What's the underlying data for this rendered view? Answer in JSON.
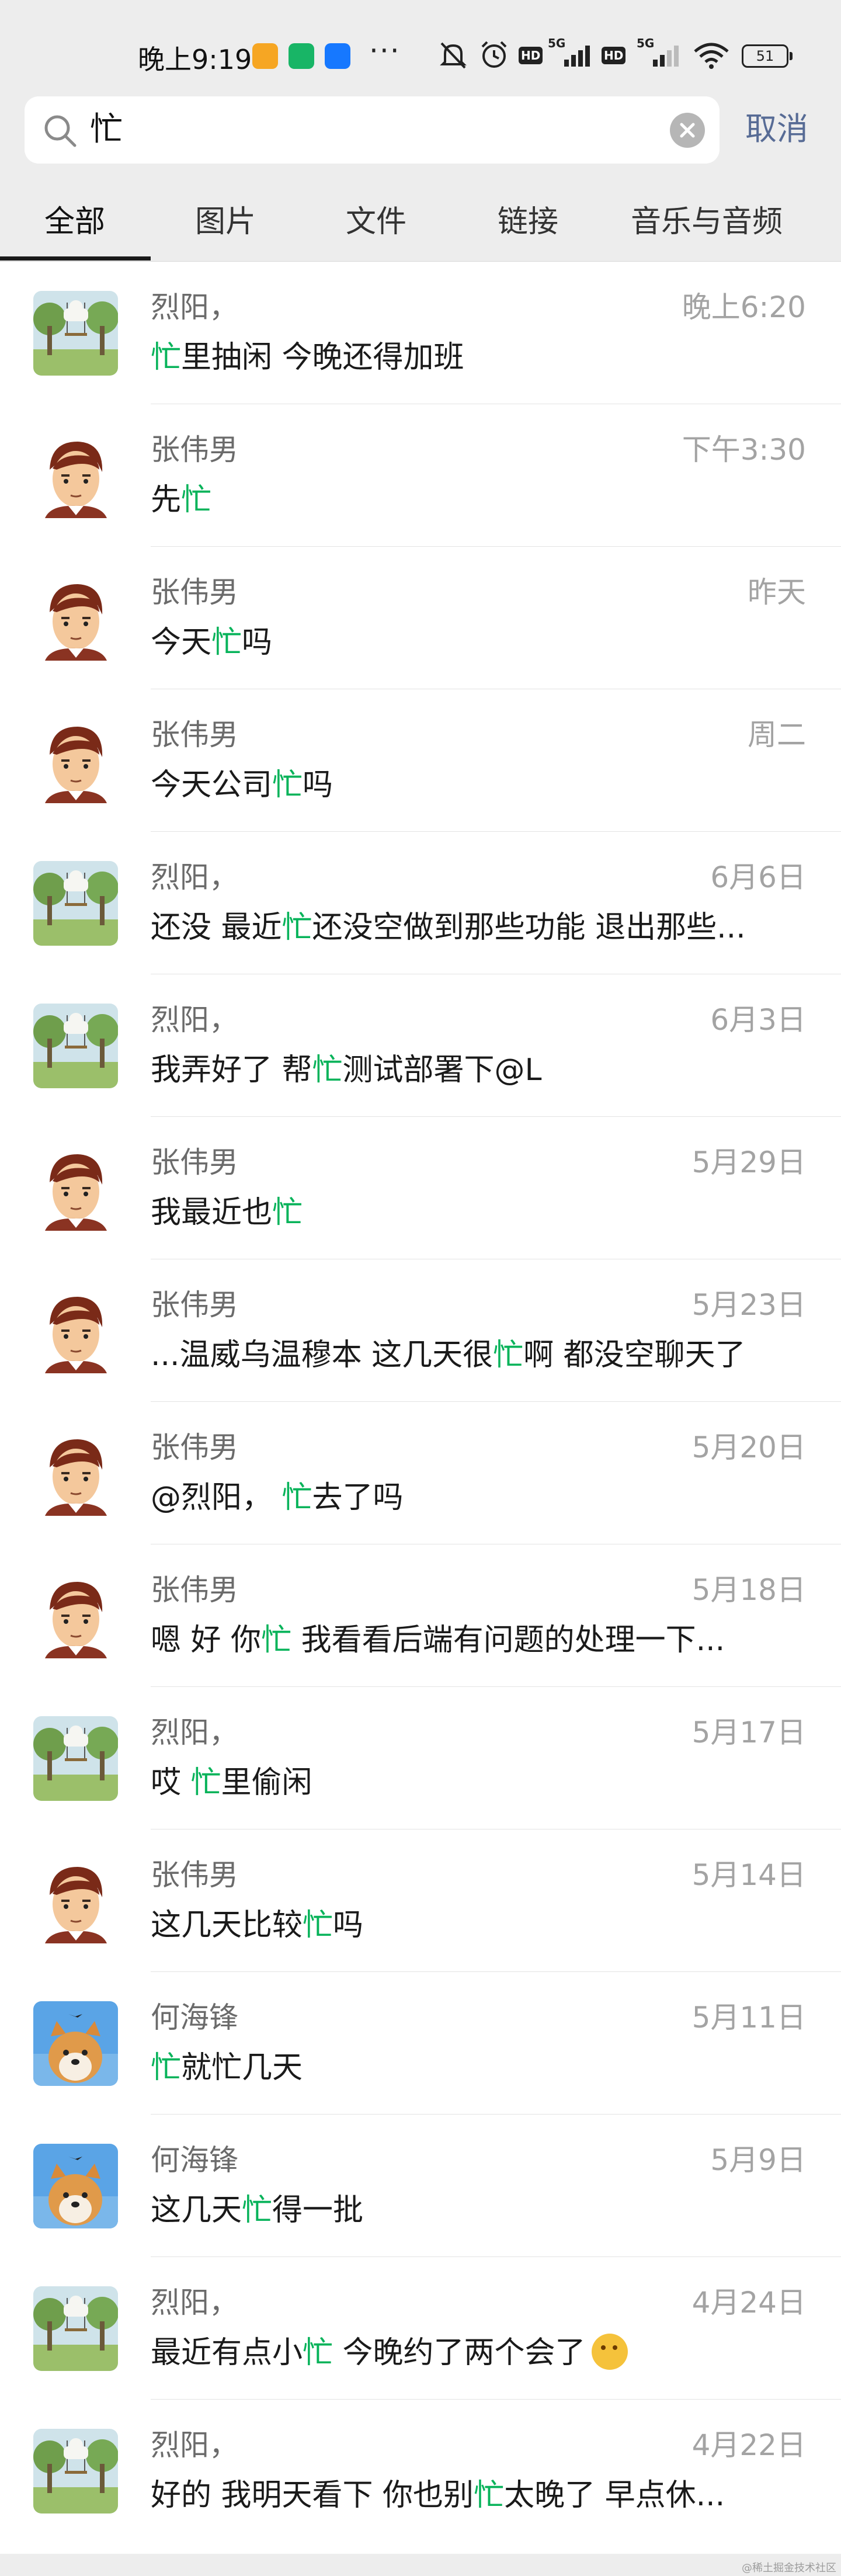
{
  "status_bar": {
    "time": "晚上9:19",
    "network_a": "5G",
    "network_b": "5G",
    "hd_a": "HD",
    "hd_b": "HD",
    "battery": "51",
    "more": "···"
  },
  "search": {
    "query": "忙",
    "cancel_label": "取消"
  },
  "tabs": [
    {
      "label": "全部",
      "active": true
    },
    {
      "label": "图片",
      "active": false
    },
    {
      "label": "文件",
      "active": false
    },
    {
      "label": "链接",
      "active": false
    },
    {
      "label": "音乐与音频",
      "active": false
    }
  ],
  "results": [
    {
      "name": "烈阳，",
      "date": "晚上6:20",
      "avatar": "park-swing-avatar",
      "before": "",
      "hl": "忙",
      "after": "里抽闲 今晚还得加班"
    },
    {
      "name": "张伟男",
      "date": "下午3:30",
      "avatar": "cartoon-man-avatar",
      "before": "先",
      "hl": "忙",
      "after": ""
    },
    {
      "name": "张伟男",
      "date": "昨天",
      "avatar": "cartoon-man-avatar",
      "before": "今天",
      "hl": "忙",
      "after": "吗"
    },
    {
      "name": "张伟男",
      "date": "周二",
      "avatar": "cartoon-man-avatar",
      "before": "今天公司",
      "hl": "忙",
      "after": "吗"
    },
    {
      "name": "烈阳，",
      "date": "6月6日",
      "avatar": "park-swing-avatar",
      "before": "还没 最近",
      "hl": "忙",
      "after": "还没空做到那些功能 退出那些..."
    },
    {
      "name": "烈阳，",
      "date": "6月3日",
      "avatar": "park-swing-avatar",
      "before": "我弄好了 帮",
      "hl": "忙",
      "after": "测试部署下@L"
    },
    {
      "name": "张伟男",
      "date": "5月29日",
      "avatar": "cartoon-man-avatar",
      "before": "我最近也",
      "hl": "忙",
      "after": ""
    },
    {
      "name": "张伟男",
      "date": "5月23日",
      "avatar": "cartoon-man-avatar",
      "before": "...温威乌温穆本 这几天很",
      "hl": "忙",
      "after": "啊 都没空聊天了"
    },
    {
      "name": "张伟男",
      "date": "5月20日",
      "avatar": "cartoon-man-avatar",
      "before": "@烈阳， ",
      "hl": "忙",
      "after": "去了吗"
    },
    {
      "name": "张伟男",
      "date": "5月18日",
      "avatar": "cartoon-man-avatar",
      "before": "嗯 好 你",
      "hl": "忙",
      "after": " 我看看后端有问题的处理一下..."
    },
    {
      "name": "烈阳，",
      "date": "5月17日",
      "avatar": "park-swing-avatar",
      "before": "哎 ",
      "hl": "忙",
      "after": "里偷闲"
    },
    {
      "name": "张伟男",
      "date": "5月14日",
      "avatar": "cartoon-man-avatar",
      "before": "这几天比较",
      "hl": "忙",
      "after": "吗"
    },
    {
      "name": "何海锋",
      "date": "5月11日",
      "avatar": "shiba-dog-avatar",
      "before": "",
      "hl": "忙",
      "after": "就忙几天"
    },
    {
      "name": "何海锋",
      "date": "5月9日",
      "avatar": "shiba-dog-avatar",
      "before": "这几天",
      "hl": "忙",
      "after": "得一批"
    },
    {
      "name": "烈阳，",
      "date": "4月24日",
      "avatar": "park-swing-avatar",
      "before": "最近有点小",
      "hl": "忙",
      "after": " 今晚约了两个会了",
      "emoji": "thinking-face-emoji"
    },
    {
      "name": "烈阳，",
      "date": "4月22日",
      "avatar": "park-swing-avatar",
      "before": "好的 我明天看下 你也别",
      "hl": "忙",
      "after": "太晚了 早点休..."
    }
  ],
  "colors": {
    "highlight": "#07b35a",
    "cancel": "#576b95",
    "background": "#ededed"
  },
  "watermark": "@稀土掘金技术社区"
}
